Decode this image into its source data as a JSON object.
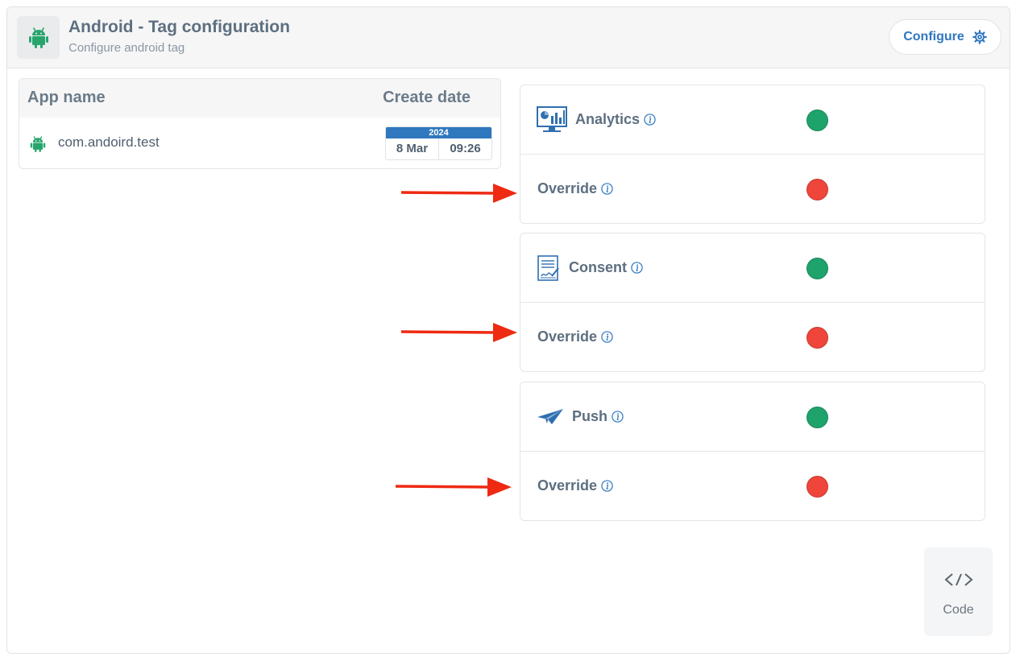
{
  "header": {
    "title": "Android - Tag configuration",
    "subtitle": "Configure android tag",
    "configure_label": "Configure"
  },
  "apps_table": {
    "columns": [
      "App name",
      "Create date"
    ],
    "rows": [
      {
        "app_name": "com.andoird.test",
        "year": "2024",
        "day": "8 Mar",
        "time": "09:26"
      }
    ]
  },
  "cards": [
    {
      "feature": "Analytics",
      "feature_icon": "analytics-dashboard-icon",
      "feature_status": "enabled",
      "override_label": "Override",
      "override_status": "disabled"
    },
    {
      "feature": "Consent",
      "feature_icon": "consent-document-icon",
      "feature_status": "enabled",
      "override_label": "Override",
      "override_status": "disabled"
    },
    {
      "feature": "Push",
      "feature_icon": "paper-plane-icon",
      "feature_status": "enabled",
      "override_label": "Override",
      "override_status": "disabled"
    }
  ],
  "code_button": {
    "label": "Code"
  },
  "colors": {
    "accent": "#2f77c0",
    "android_green": "#27a56c",
    "status_enabled": "#1ea36c",
    "status_disabled": "#f0453a",
    "annotation_arrow": "#ee2a12"
  }
}
